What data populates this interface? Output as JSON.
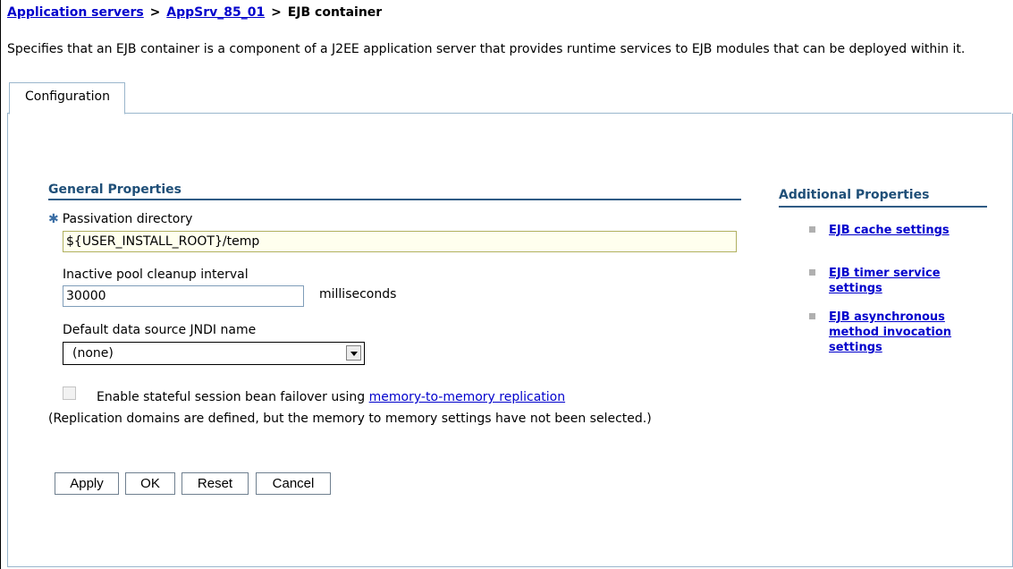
{
  "breadcrumb": {
    "items": [
      "Application servers",
      "AppSrv_85_01"
    ],
    "separator": ">",
    "current": "EJB container"
  },
  "description": "Specifies that an EJB container is a component of a J2EE application server that provides runtime services to EJB modules that can be deployed within it.",
  "tabs": [
    {
      "label": "Configuration",
      "active": true
    }
  ],
  "general_properties": {
    "title": "General Properties",
    "passivation": {
      "label": "Passivation directory",
      "required": true,
      "value": "${USER_INSTALL_ROOT}/temp"
    },
    "cleanup": {
      "label": "Inactive pool cleanup interval",
      "value": "30000",
      "unit": "milliseconds"
    },
    "jndi": {
      "label": "Default data source JNDI name",
      "selected": "(none)"
    },
    "failover": {
      "checked": false,
      "label_text": "Enable stateful session bean failover using",
      "link_text": "memory-to-memory replication",
      "note": "(Replication domains are defined, but the memory to memory settings have not been selected.)"
    },
    "buttons": {
      "apply": "Apply",
      "ok": "OK",
      "reset": "Reset",
      "cancel": "Cancel"
    }
  },
  "additional_properties": {
    "title": "Additional Properties",
    "links": [
      "EJB cache settings",
      "EJB timer service settings",
      "EJB asynchronous method invocation settings"
    ]
  },
  "colors": {
    "link": "#0000cc",
    "section_title": "#1f4f78",
    "section_rule": "#2f5b85",
    "required_field_bg": "#ffffee",
    "tab_border": "#9ab6cc"
  }
}
